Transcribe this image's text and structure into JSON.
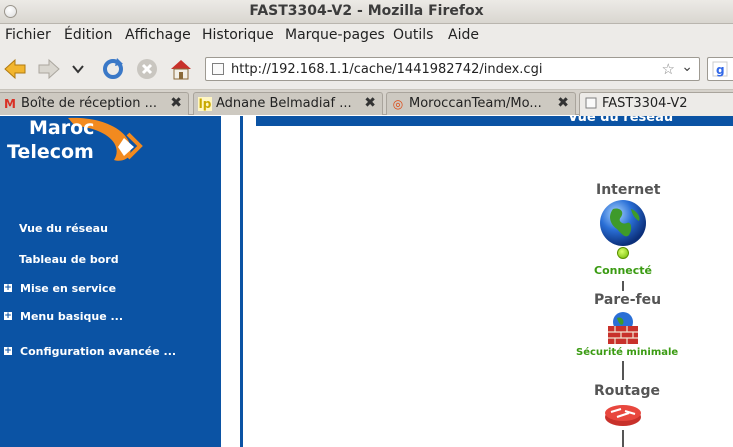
{
  "window": {
    "title": "FAST3304-V2 - Mozilla Firefox"
  },
  "menu": [
    "Fichier",
    "Édition",
    "Affichage",
    "Historique",
    "Marque-pages",
    "Outils",
    "Aide"
  ],
  "url": "http://192.168.1.1/cache/1441982742/index.cgi",
  "tabs": [
    {
      "label": "Boîte de réception ...",
      "icon": "gmail-icon"
    },
    {
      "label": "Adnane Belmadiaf ...",
      "icon": "lp-icon"
    },
    {
      "label": "MoroccanTeam/Mo...",
      "icon": "ubuntu-icon"
    },
    {
      "label": "FAST3304-V2",
      "icon": "page-icon",
      "active": true
    }
  ],
  "brand": {
    "line1": "Maroc",
    "line2": "Telecom"
  },
  "sidebar": {
    "items": [
      {
        "label": "Vue du réseau",
        "expandable": false
      },
      {
        "label": "Tableau de bord",
        "expandable": false
      },
      {
        "label": "Mise en service",
        "expandable": true
      },
      {
        "label": "Menu basique ...",
        "expandable": true
      },
      {
        "label": "Configuration avancée ...",
        "expandable": true
      }
    ]
  },
  "main": {
    "header": "Vue du réseau",
    "nodes": [
      {
        "label": "Internet",
        "status": "Connecté",
        "icon": "globe-icon"
      },
      {
        "label": "Pare-feu",
        "status": "Sécurité minimale",
        "icon": "firewall-icon"
      },
      {
        "label": "Routage",
        "icon": "router-icon"
      }
    ]
  },
  "colors": {
    "sidebar": "#0b53a4",
    "accent": "#f28a1f",
    "status_ok": "#3a9b12"
  }
}
